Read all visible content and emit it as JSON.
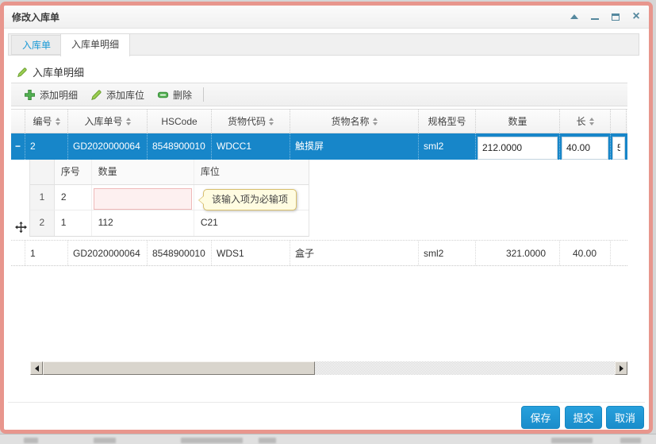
{
  "dialog": {
    "title": "修改入库单"
  },
  "tabs": {
    "inbound": "入库单",
    "inbound_detail": "入库单明细"
  },
  "panel": {
    "header": "入库单明细"
  },
  "toolbar": {
    "add_detail": "添加明细",
    "add_location": "添加库位",
    "delete": "删除"
  },
  "grid": {
    "headers": {
      "id": "编号",
      "order_no": "入库单号",
      "hscode": "HSCode",
      "cargo_code": "货物代码",
      "cargo_name": "货物名称",
      "spec": "规格型号",
      "qty": "数量",
      "length": "长"
    },
    "selected_row": {
      "collapse_icon": "−",
      "id": "2",
      "order_no": "GD2020000064",
      "hscode": "8548900010",
      "cargo_code": "WDCC1",
      "cargo_name": "触摸屏",
      "spec": "sml2",
      "qty": "212.0000",
      "length": "40.00",
      "next_col_partial": "5"
    },
    "row_1": {
      "id": "1",
      "order_no": "GD2020000064",
      "hscode": "8548900010",
      "cargo_code": "WDS1",
      "cargo_name": "盒子",
      "spec": "sml2",
      "qty": "321.0000",
      "length": "40.00"
    }
  },
  "subgrid": {
    "headers": {
      "seq": "序号",
      "qty": "数量",
      "location": "库位"
    },
    "rows": [
      {
        "num": "1",
        "seq": "2",
        "qty": "",
        "location": ""
      },
      {
        "num": "2",
        "seq": "1",
        "qty": "112",
        "location": "C21"
      }
    ]
  },
  "validation": {
    "required_tooltip": "该输入项为必输项"
  },
  "footer": {
    "save": "保存",
    "submit": "提交",
    "cancel": "取消"
  },
  "icons": {
    "toolbar_add": "plus-icon",
    "toolbar_edit": "pencil-icon",
    "toolbar_delete": "minus-pill-icon",
    "panel": "pencil-icon",
    "row_collapse": "minus-icon",
    "drag": "move-cross-icon",
    "window": [
      "collapse-icon",
      "minimize-icon",
      "maximize-icon",
      "close-icon"
    ]
  },
  "colors": {
    "accent_blue": "#1c95d4",
    "selected_row_blue": "#1786c9",
    "dialog_border": "#e8968d",
    "tab_link_blue": "#1b9ad6",
    "icon_green": "#52b051",
    "error_border": "#efb9b9",
    "error_bg": "#fdf0f0",
    "tooltip_bg": "#fffce1",
    "tooltip_border": "#d8bf6e"
  }
}
